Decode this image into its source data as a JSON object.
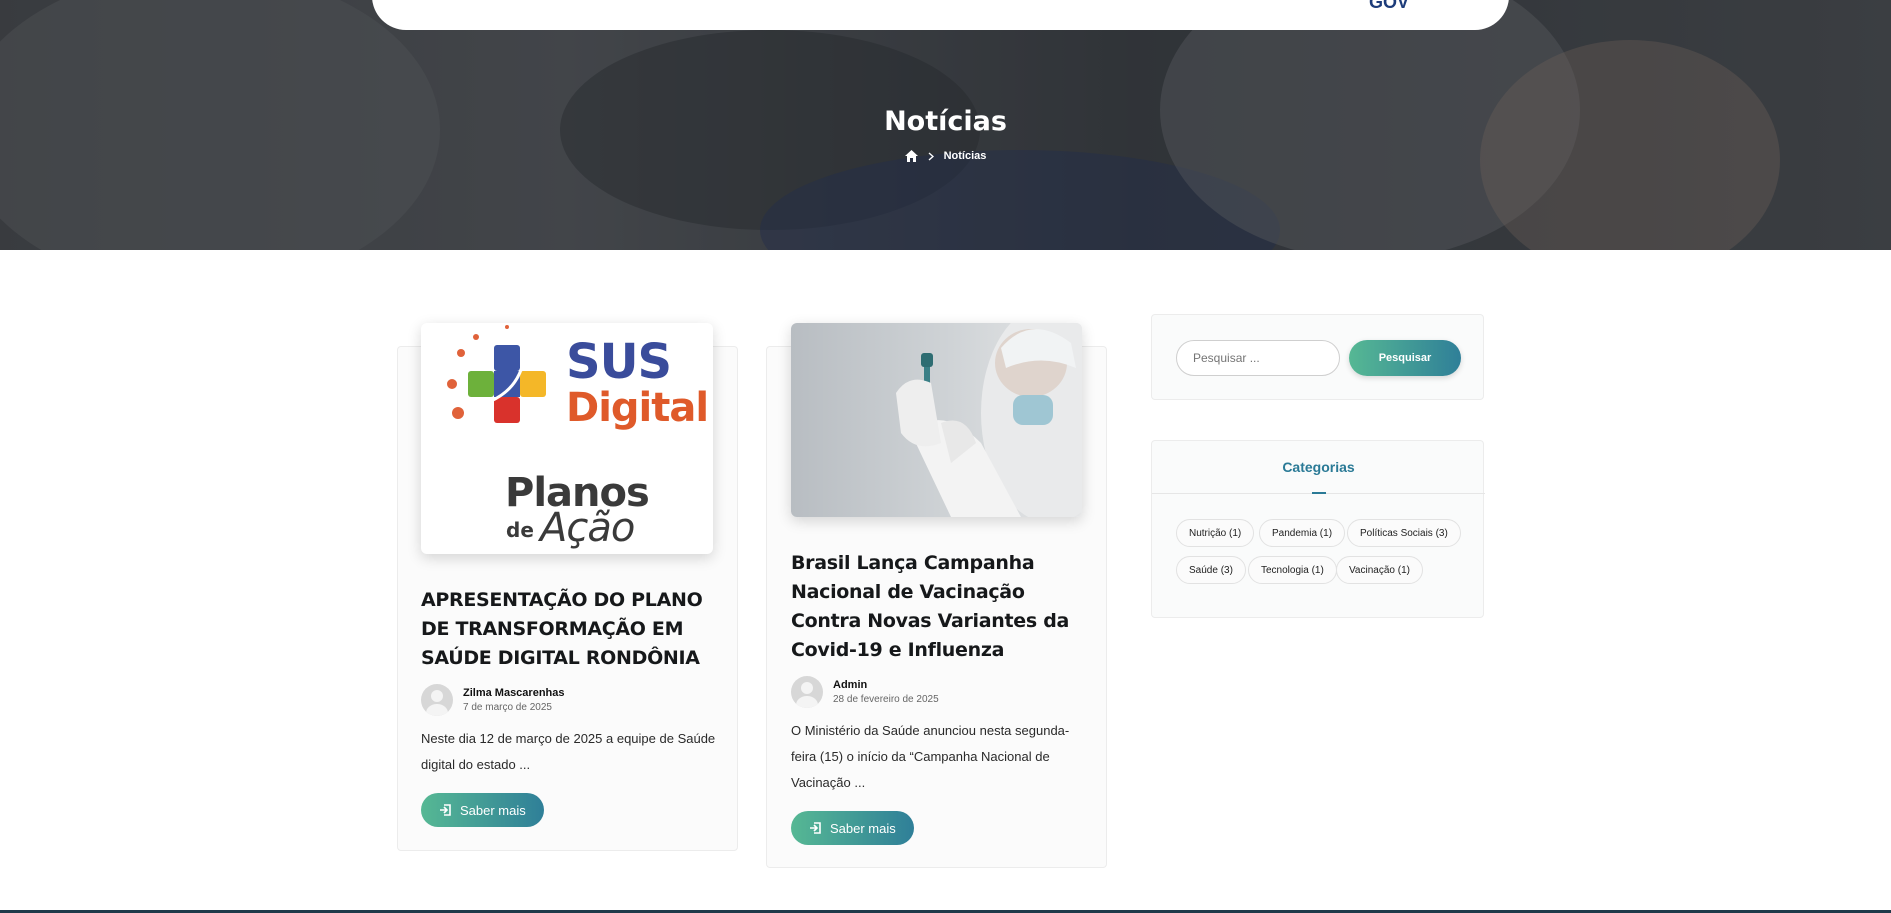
{
  "header": {
    "title": "Notícias",
    "breadcrumb": {
      "home_icon": "home-icon",
      "separator_icon": "chevron-right-icon",
      "current": "Notícias"
    }
  },
  "posts": [
    {
      "image": {
        "brand_title": "SUS",
        "brand_subtitle": "Digital",
        "plan_title": "Planos",
        "plan_de": "de",
        "plan_action": "Ação"
      },
      "title": "APRESENTAÇÃO DO PLANO DE TRANSFORMAÇÃO EM SAÚDE DIGITAL RONDÔNIA",
      "author": "Zilma Mascarenhas",
      "date": "7 de março de 2025",
      "excerpt": "Neste dia 12 de março de 2025 a equipe de Saúde digital do estado ...",
      "button": "Saber mais"
    },
    {
      "title": "Brasil Lança Campanha Nacional de Vacinação Contra Novas Variantes da Covid-19 e Influenza",
      "author": "Admin",
      "date": "28 de fevereiro de 2025",
      "excerpt": "O Ministério da Saúde anunciou nesta segunda-feira (15) o início da “Campanha Nacional de Vacinação ...",
      "button": "Saber mais"
    }
  ],
  "sidebar": {
    "search": {
      "placeholder": "Pesquisar ...",
      "button": "Pesquisar"
    },
    "categories": {
      "title": "Categorias",
      "items": [
        "Nutrição (1)",
        "Pandemia (1)",
        "Políticas Sociais (3)",
        "Saúde (3)",
        "Tecnologia (1)",
        "Vacinação (1)"
      ]
    }
  },
  "colors": {
    "accent": "#2a7a96",
    "gradient_start": "#56b894",
    "gradient_end": "#2f7f98"
  }
}
